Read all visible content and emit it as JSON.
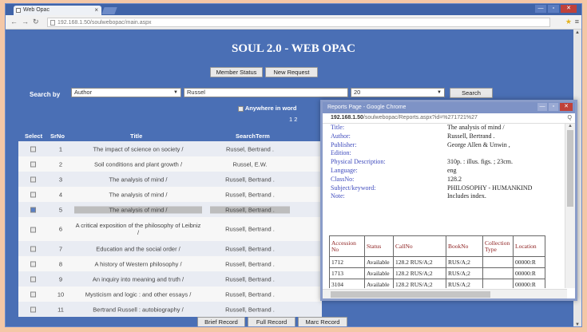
{
  "browser": {
    "tab_title": "Web Opac",
    "tab_close": "×",
    "url": "192.168.1.50/soulwebopac/main.aspx",
    "window_controls": [
      "—",
      "▫",
      "✕"
    ]
  },
  "page": {
    "title": "SOUL 2.0 - WEB OPAC",
    "member_status": "Member Status",
    "new_request": "New Request",
    "search_by_label": "Search by",
    "search_field": "Author",
    "search_value": "Russel",
    "page_size": "20",
    "search_button": "Search",
    "anywhere_label": "Anywhere in word",
    "page_numbers": "1 2"
  },
  "table": {
    "headers": {
      "select": "Select",
      "srno": "SrNo",
      "title": "Title",
      "term": "SearchTerm"
    },
    "rows": [
      {
        "no": "1",
        "title": "The impact of science on society /",
        "term": "Russel, Bertrand .",
        "checked": false
      },
      {
        "no": "2",
        "title": "Soil conditions and plant growth /",
        "term": "Russel, E.W.",
        "checked": false
      },
      {
        "no": "3",
        "title": "The analysis of mind /",
        "term": "Russell, Bertrand .",
        "checked": false
      },
      {
        "no": "4",
        "title": "The analysis of mind /",
        "term": "Russell, Bertrand .",
        "checked": false
      },
      {
        "no": "5",
        "title": "The analysis of mind /",
        "term": "Russell, Bertrand .",
        "checked": true
      },
      {
        "no": "6",
        "title": "A critical exposition of the philosophy of Leibniz /",
        "term": "Russell, Bertrand .",
        "checked": false
      },
      {
        "no": "7",
        "title": "Education and the social order /",
        "term": "Russell, Bertrand .",
        "checked": false
      },
      {
        "no": "8",
        "title": "A history of Western philosophy /",
        "term": "Russell, Bertrand .",
        "checked": false
      },
      {
        "no": "9",
        "title": "An inquiry into meaning and truth /",
        "term": "Russell, Bertrand .",
        "checked": false
      },
      {
        "no": "10",
        "title": "Mysticism and logic : and other essays /",
        "term": "Russell, Bertrand .",
        "checked": false
      },
      {
        "no": "11",
        "title": "Bertrand Russell : autobiography /",
        "term": "Russell, Bertrand .",
        "checked": false
      }
    ]
  },
  "pager_buttons": {
    "brief": "Brief Record",
    "full": "Full Record",
    "marc": "Marc Record"
  },
  "popup": {
    "window_title": "Reports Page - Google Chrome",
    "url_host": "192.168.1.50",
    "url_path": "/soulwebopac/Reports.aspx?id=%271721%27",
    "zoom_icon": "Q",
    "details": [
      {
        "k": "Title:",
        "v": "The analysis of mind /"
      },
      {
        "k": "Author:",
        "v": "Russell, Bertrand ."
      },
      {
        "k": "Publisher:",
        "v": "George Allen & Unwin ,"
      },
      {
        "k": "Edition:",
        "v": ""
      },
      {
        "k": "Physical Description:",
        "v": "310p. : illus. figs. ; 23cm."
      },
      {
        "k": "Language:",
        "v": "eng"
      },
      {
        "k": "ClassNo:",
        "v": "128.2"
      },
      {
        "k": "Subject/keyword:",
        "v": "PHILOSOPHY - HUMANKIND"
      },
      {
        "k": "Note:",
        "v": "Includes index."
      }
    ],
    "copies_headers": [
      "Accession No",
      "Status",
      "CallNo",
      "BookNo",
      "Collection Type",
      "Location"
    ],
    "copies": [
      [
        "1712",
        "Available",
        "128.2 RUS/A;2",
        "RUS/A;2",
        "",
        "00000:R"
      ],
      [
        "1713",
        "Available",
        "128.2 RUS/A;2",
        "RUS/A;2",
        "",
        "00000:R"
      ],
      [
        "3104",
        "Available",
        "128.2 RUS/A;2",
        "RUS/A;2",
        "",
        "00000:R"
      ]
    ]
  }
}
